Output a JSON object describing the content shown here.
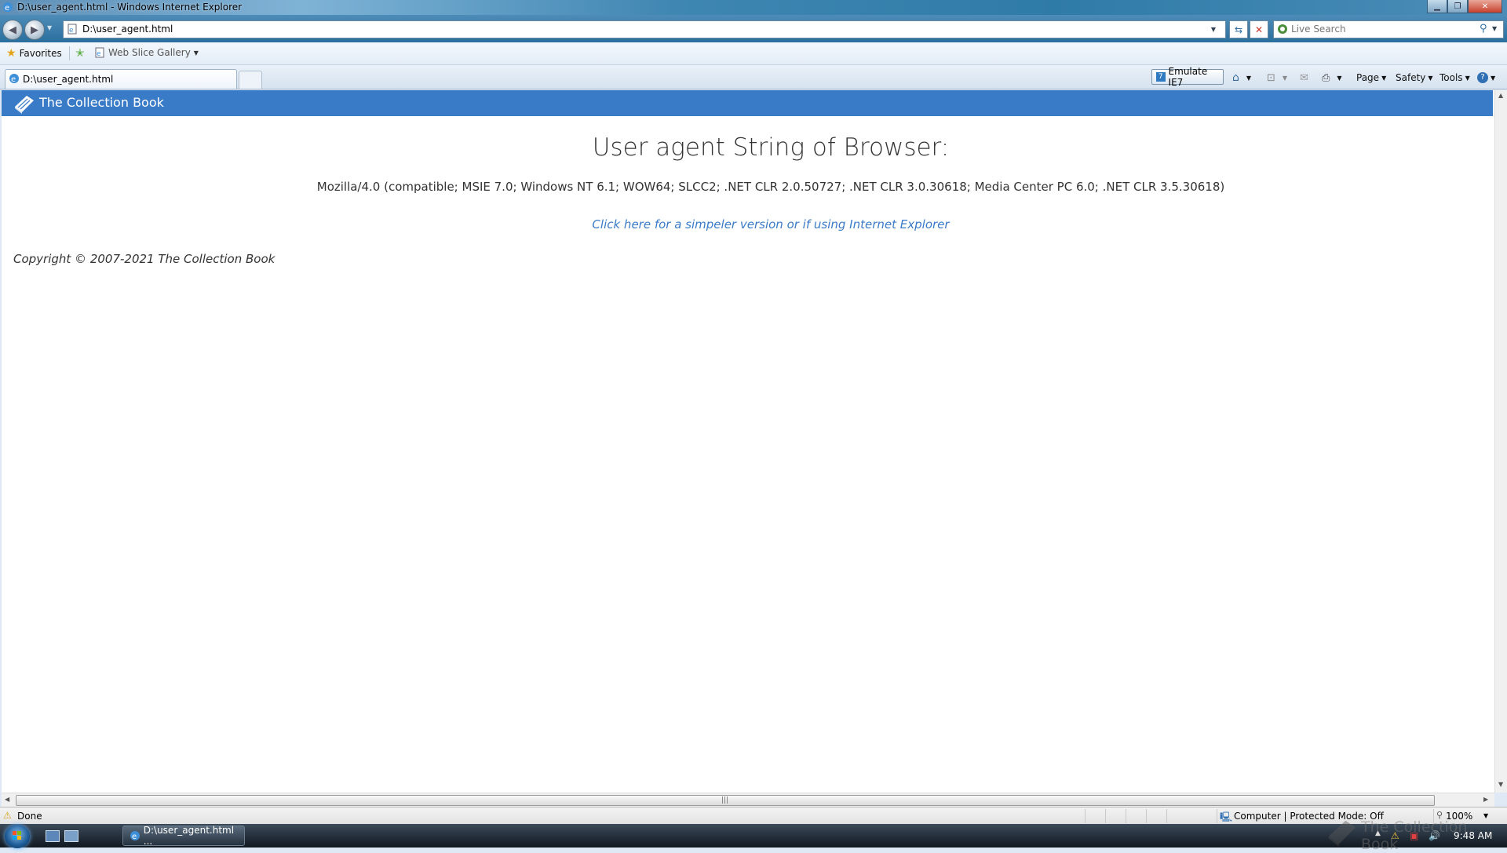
{
  "window": {
    "title": "D:\\user_agent.html - Windows Internet Explorer",
    "controls": [
      "minimize",
      "restore",
      "close"
    ]
  },
  "navbar": {
    "address": "D:\\user_agent.html",
    "search_placeholder": "Live Search"
  },
  "favorites_bar": {
    "favorites_label": "Favorites",
    "web_slice_label": "Web Slice Gallery"
  },
  "tabs": [
    {
      "label": "D:\\user_agent.html"
    }
  ],
  "command_bar": {
    "emulate_label": "Emulate IE7",
    "page_label": "Page",
    "safety_label": "Safety",
    "tools_label": "Tools"
  },
  "page": {
    "brand": "The Collection Book",
    "heading": "User agent String of Browser:",
    "user_agent": "Mozilla/4.0 (compatible; MSIE 7.0; Windows NT 6.1; WOW64; SLCC2; .NET CLR 2.0.50727; .NET CLR 3.0.30618; Media Center PC 6.0; .NET CLR 3.5.30618)",
    "simple_link": "Click here for a simpeler version or if using Internet Explorer",
    "copyright": "Copyright © 2007-2021 The Collection Book"
  },
  "statusbar": {
    "status": "Done",
    "zone": "Computer | Protected Mode: Off",
    "zoom": "100%"
  },
  "taskbar": {
    "item_label": "D:\\user_agent.html ...",
    "clock": "9:48 AM"
  },
  "watermark": {
    "text": "The Collection Book"
  },
  "colors": {
    "site_header": "#3a7bc8",
    "link": "#3a7bc8",
    "text": "#333333"
  }
}
